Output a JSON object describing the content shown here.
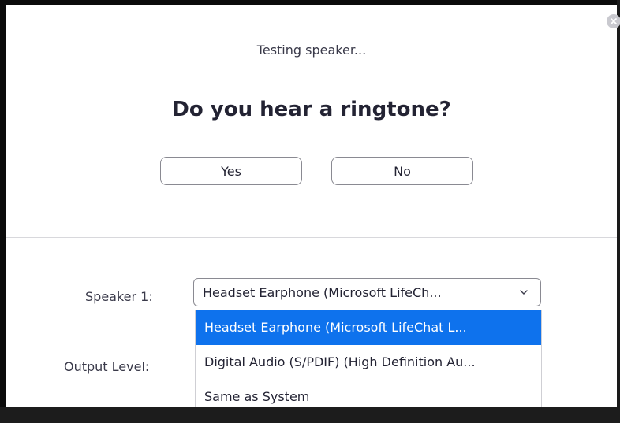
{
  "dialog": {
    "status": "Testing speaker...",
    "question": "Do you hear a ringtone?",
    "yes_label": "Yes",
    "no_label": "No"
  },
  "speaker": {
    "label": "Speaker 1:",
    "selected": "Headset Earphone (Microsoft LifeCh...",
    "options": [
      "Headset Earphone (Microsoft LifeChat L...",
      "Digital Audio (S/PDIF) (High Definition Au...",
      "Same as System"
    ]
  },
  "output": {
    "label": "Output Level:"
  },
  "colors": {
    "accent": "#0e72ed",
    "text": "#232333",
    "border": "#8a8a92"
  },
  "icons": {
    "close": "close-icon",
    "chevron": "chevron-down-icon"
  }
}
